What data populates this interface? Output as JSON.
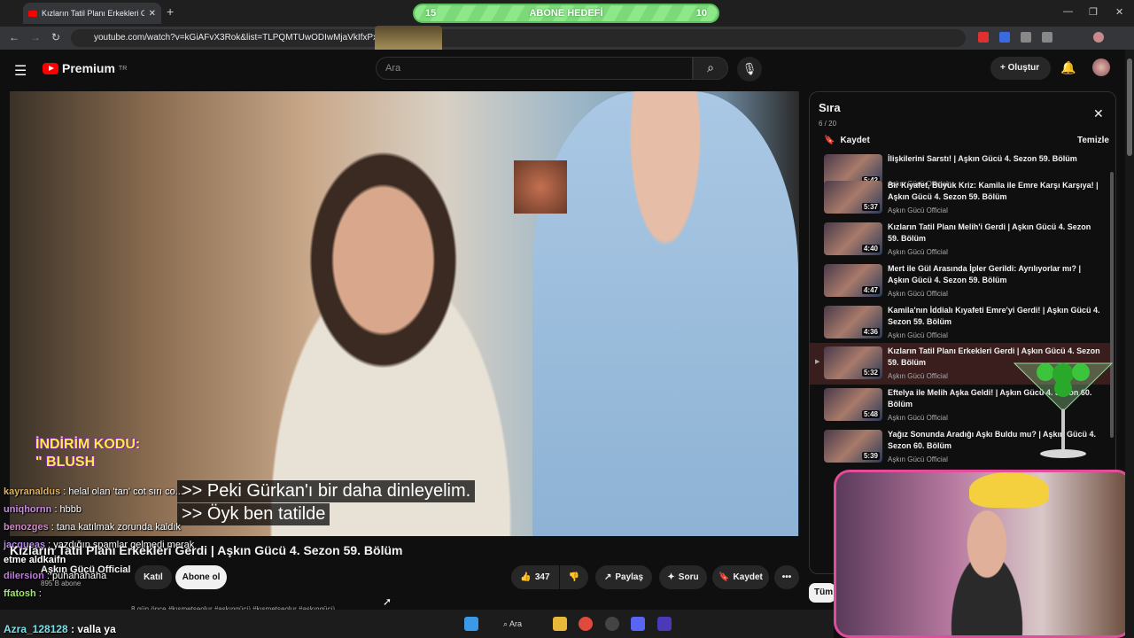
{
  "browser": {
    "tab_title": "Kızların Tatil Planı Erkekleri Gerdi",
    "url": "youtube.com/watch?v=kGiAFvX3Rok&list=TLPQMTUwODIwMjaVkIfxPxCW6A",
    "goal_left": "15",
    "goal_label": "ABONE HEDEFİ",
    "goal_right": "10"
  },
  "header": {
    "logo_text": "Premium",
    "logo_region": "TR",
    "search_placeholder": "Ara",
    "create_label": "Oluştur"
  },
  "video": {
    "promo_line1": "İNDİRİM KODU:",
    "promo_line2": "\" BLUSH",
    "caption1": ">> Peki Gürkan'ı bir daha dinleyelim.",
    "caption2": ">> Öyk ben tatilde",
    "title": "Kızların Tatil Planı Erkekleri Gerdi | Aşkın Gücü 4. Sezon 59. Bölüm",
    "channel": "Aşkın Gücü Official",
    "subs": "895 B abone",
    "join_label": "Katıl",
    "subscribe_label": "Abone ol",
    "likes": "347",
    "share_label": "Paylaş",
    "ask_label": "Soru",
    "save_label": "Kaydet",
    "desc": "#kısmetseolur #aşkıngücü #kısmetseolur #aşkıngücü",
    "ago": "8 gün önce"
  },
  "chat": [
    {
      "name": "kayranaldus",
      "msg": ": helal olan 'tan' cot sırı co...",
      "color": "#e0b25a"
    },
    {
      "name": "uniqhornn",
      "msg": ": hbbb",
      "color": "#c88ae0"
    },
    {
      "name": "benozges",
      "msg": ": tana katılmak zorunda kaldık",
      "color": "#d08ac8"
    },
    {
      "name": "jacqueas",
      "msg": ": yazdığın spamlar gelmedi merak",
      "color": "#b68ae8"
    },
    {
      "name": "etme aldkaifn",
      "msg": "",
      "color": "#ffffff"
    },
    {
      "name": "dilersion",
      "msg": ": puhahahaha",
      "color": "#c27ae0"
    },
    {
      "name": "ffatosh",
      "msg": ":",
      "color": "#9ee86a"
    }
  ],
  "last_chat": {
    "name": "Azra_128128",
    "msg": ": valla ya"
  },
  "playlist": {
    "title": "Sıra",
    "count": "6 / 20",
    "save_label": "Kaydet",
    "clear_label": "Temizle",
    "items": [
      {
        "title": "İlişkilerini Sarstı! | Aşkın Gücü 4. Sezon 59. Bölüm",
        "channel": "Aşkın Gücü Official",
        "duration": "5:42"
      },
      {
        "title": "Bir Kıyafet, Büyük Kriz: Kamila ile Emre Karşı Karşıya! | Aşkın Gücü 4. Sezon 59. Bölüm",
        "channel": "Aşkın Gücü Official",
        "duration": "5:37"
      },
      {
        "title": "Kızların Tatil Planı Melih'i Gerdi | Aşkın Gücü 4. Sezon 59. Bölüm",
        "channel": "Aşkın Gücü Official",
        "duration": "4:40"
      },
      {
        "title": "Mert ile Gül Arasında İpler Gerildi: Ayrılıyorlar mı? | Aşkın Gücü 4. Sezon 59. Bölüm",
        "channel": "Aşkın Gücü Official",
        "duration": "4:47"
      },
      {
        "title": "Kamila'nın İddialı Kıyafeti Emre'yi Gerdi! | Aşkın Gücü 4. Sezon 59. Bölüm",
        "channel": "Aşkın Gücü Official",
        "duration": "4:36"
      },
      {
        "title": "Kızların Tatil Planı Erkekleri Gerdi | Aşkın Gücü 4. Sezon 59. Bölüm",
        "channel": "Aşkın Gücü Official",
        "duration": "5:32",
        "active": true
      },
      {
        "title": "Eftelya ile Melih Aşka Geldi! | Aşkın Gücü 4. Sezon 60. Bölüm",
        "channel": "Aşkın Gücü Official",
        "duration": "5:48"
      },
      {
        "title": "Yağız Sonunda Aradığı Aşkı Buldu mu? | Aşkın Gücü 4. Sezon 60. Bölüm",
        "channel": "Aşkın Gücü Official",
        "duration": "5:39"
      }
    ],
    "filter_label": "Tüm"
  },
  "taskbar": {
    "search_label": "Ara"
  }
}
